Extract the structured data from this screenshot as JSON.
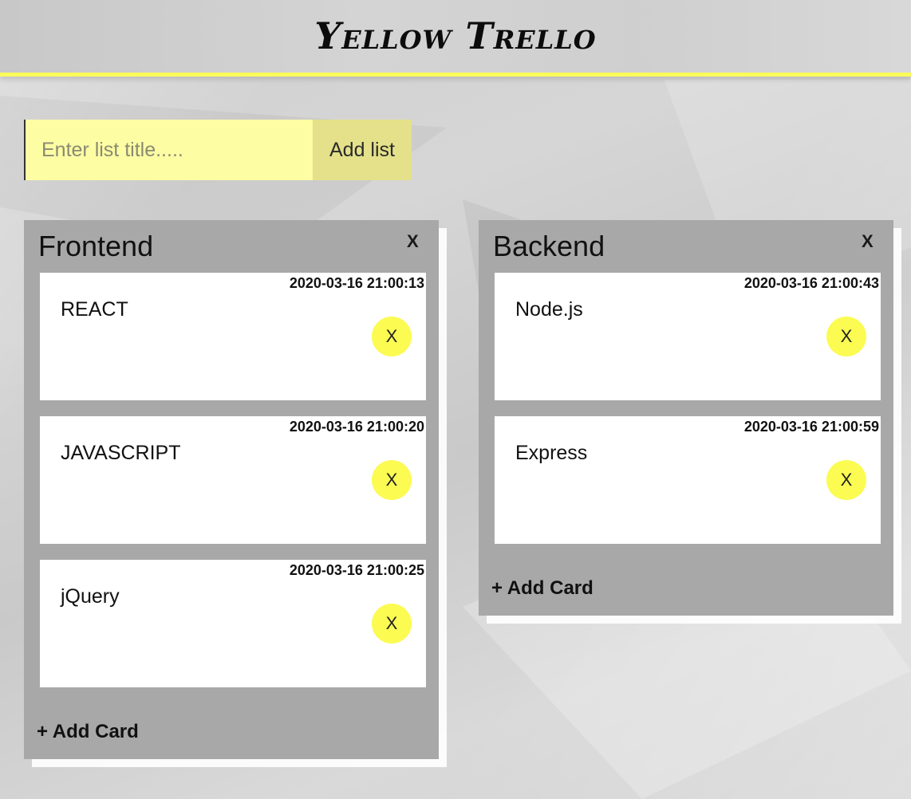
{
  "header": {
    "title": "Yellow Trello"
  },
  "add_list": {
    "placeholder": "Enter list title.....",
    "value": "",
    "button_label": "Add list"
  },
  "lists": [
    {
      "title": "Frontend",
      "close_label": "X",
      "cards": [
        {
          "timestamp": "2020-03-16 21:00:13",
          "text": "REACT",
          "delete_label": "X"
        },
        {
          "timestamp": "2020-03-16 21:00:20",
          "text": "JAVASCRIPT",
          "delete_label": "X"
        },
        {
          "timestamp": "2020-03-16 21:00:25",
          "text": "jQuery",
          "delete_label": "X"
        }
      ],
      "add_card_label": "+ Add Card"
    },
    {
      "title": "Backend",
      "close_label": "X",
      "cards": [
        {
          "timestamp": "2020-03-16 21:00:43",
          "text": "Node.js",
          "delete_label": "X"
        },
        {
          "timestamp": "2020-03-16 21:00:59",
          "text": "Express",
          "delete_label": "X"
        }
      ],
      "add_card_label": "+ Add Card"
    }
  ],
  "colors": {
    "accent": "#fbfb5a",
    "input_bg": "#fdfda4",
    "list_bg": "#a8a8a8"
  }
}
